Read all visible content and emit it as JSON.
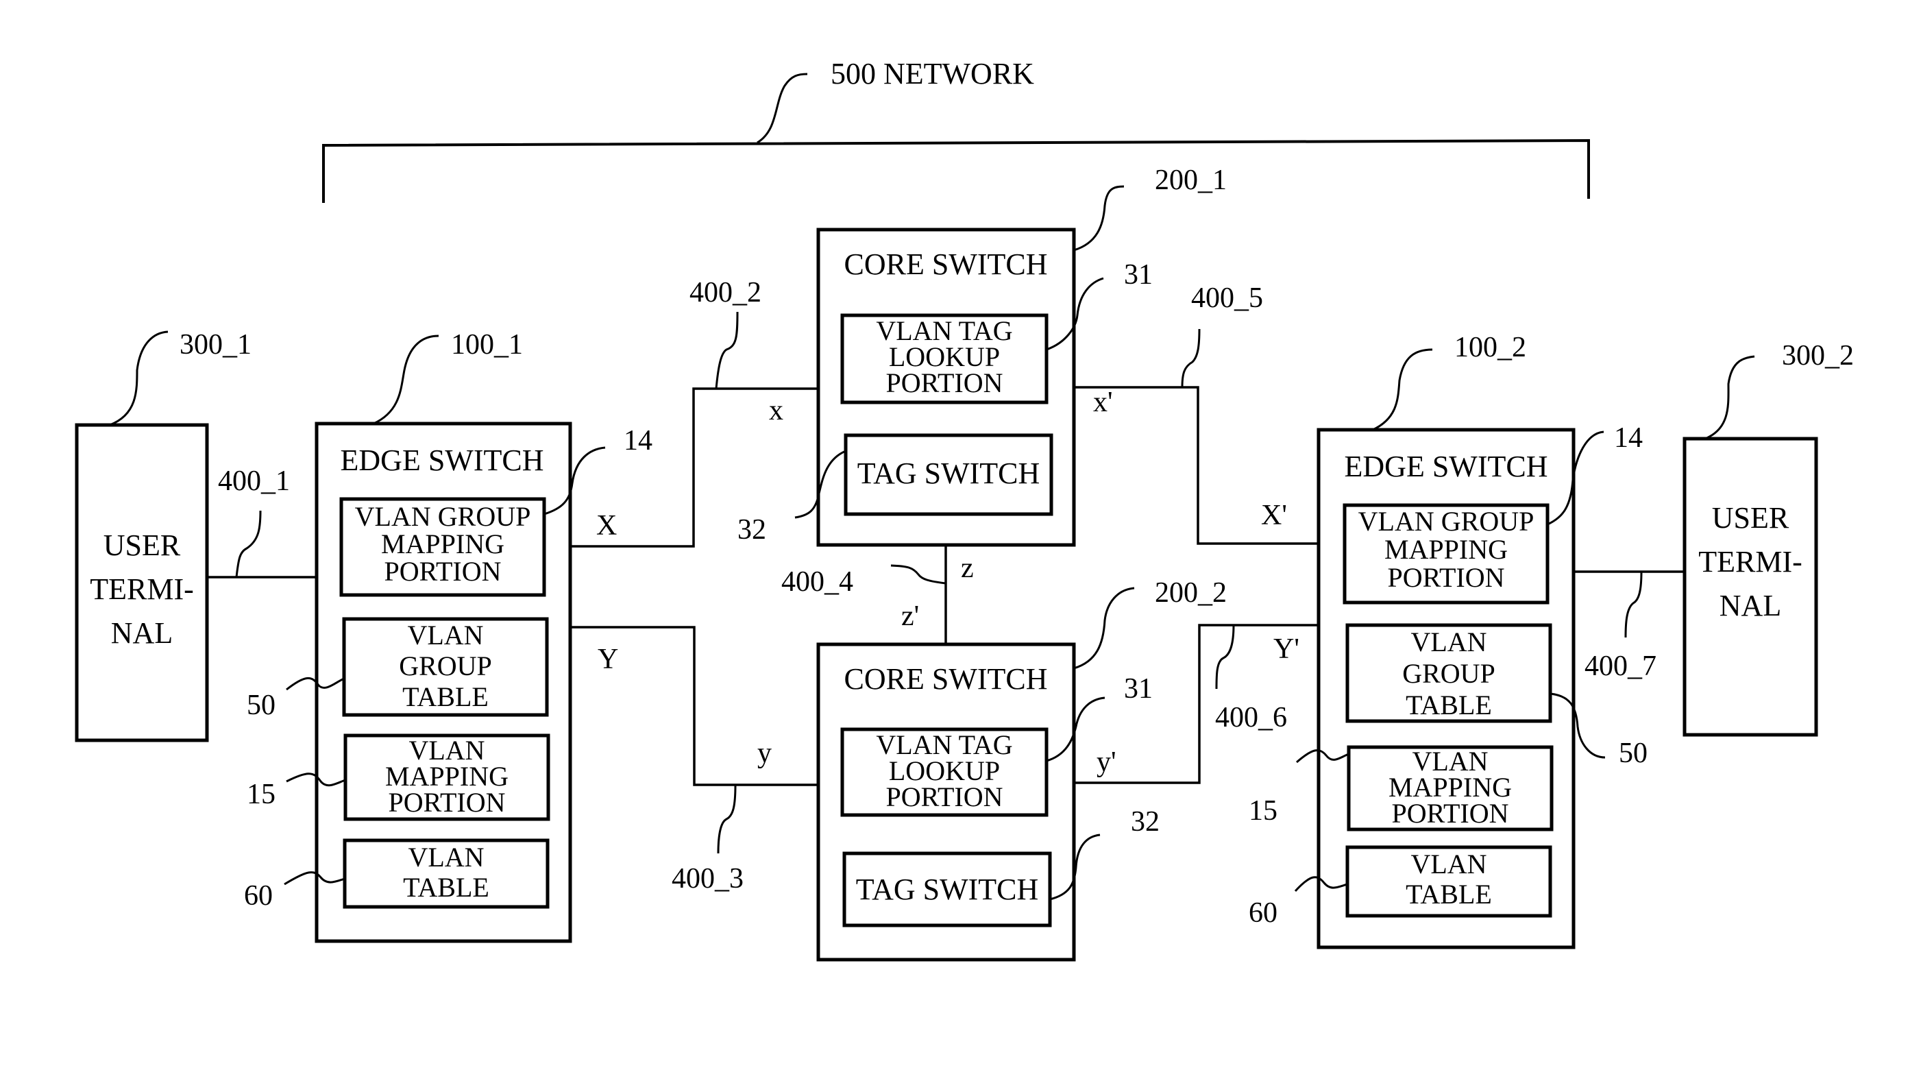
{
  "network": {
    "label": "500 NETWORK"
  },
  "user_terminals": [
    {
      "ref": "300_1",
      "lines": [
        "USER",
        "TERMI-",
        "NAL"
      ]
    },
    {
      "ref": "300_2",
      "lines": [
        "USER",
        "TERMI-",
        "NAL"
      ]
    }
  ],
  "edge_switches": [
    {
      "ref": "100_1",
      "title": "EDGE SWITCH",
      "blocks": [
        {
          "ref": "14",
          "lines": [
            "VLAN GROUP",
            "MAPPING",
            "PORTION"
          ]
        },
        {
          "ref": "50",
          "lines": [
            "VLAN",
            "GROUP",
            "TABLE"
          ]
        },
        {
          "ref": "15",
          "lines": [
            "VLAN",
            "MAPPING",
            "PORTION"
          ]
        },
        {
          "ref": "60",
          "lines": [
            "VLAN",
            "TABLE"
          ]
        }
      ],
      "ports": [
        "X",
        "Y"
      ]
    },
    {
      "ref": "100_2",
      "title": "EDGE SWITCH",
      "blocks": [
        {
          "ref": "14",
          "lines": [
            "VLAN GROUP",
            "MAPPING",
            "PORTION"
          ]
        },
        {
          "ref": "50",
          "lines": [
            "VLAN",
            "GROUP",
            "TABLE"
          ]
        },
        {
          "ref": "15",
          "lines": [
            "VLAN",
            "MAPPING",
            "PORTION"
          ]
        },
        {
          "ref": "60",
          "lines": [
            "VLAN",
            "TABLE"
          ]
        }
      ],
      "ports": [
        "X'",
        "Y'"
      ]
    }
  ],
  "core_switches": [
    {
      "ref": "200_1",
      "title": "CORE SWITCH",
      "blocks": [
        {
          "ref": "31",
          "lines": [
            "VLAN TAG",
            "LOOKUP",
            "PORTION"
          ]
        },
        {
          "ref": "32",
          "lines": [
            "TAG SWITCH"
          ]
        }
      ],
      "ports": [
        "x",
        "x'",
        "z"
      ]
    },
    {
      "ref": "200_2",
      "title": "CORE SWITCH",
      "blocks": [
        {
          "ref": "31",
          "lines": [
            "VLAN TAG",
            "LOOKUP",
            "PORTION"
          ]
        },
        {
          "ref": "32",
          "lines": [
            "TAG SWITCH"
          ]
        }
      ],
      "ports": [
        "y",
        "y'",
        "z'"
      ]
    }
  ],
  "links": [
    "400_1",
    "400_2",
    "400_3",
    "400_4",
    "400_5",
    "400_6",
    "400_7"
  ]
}
